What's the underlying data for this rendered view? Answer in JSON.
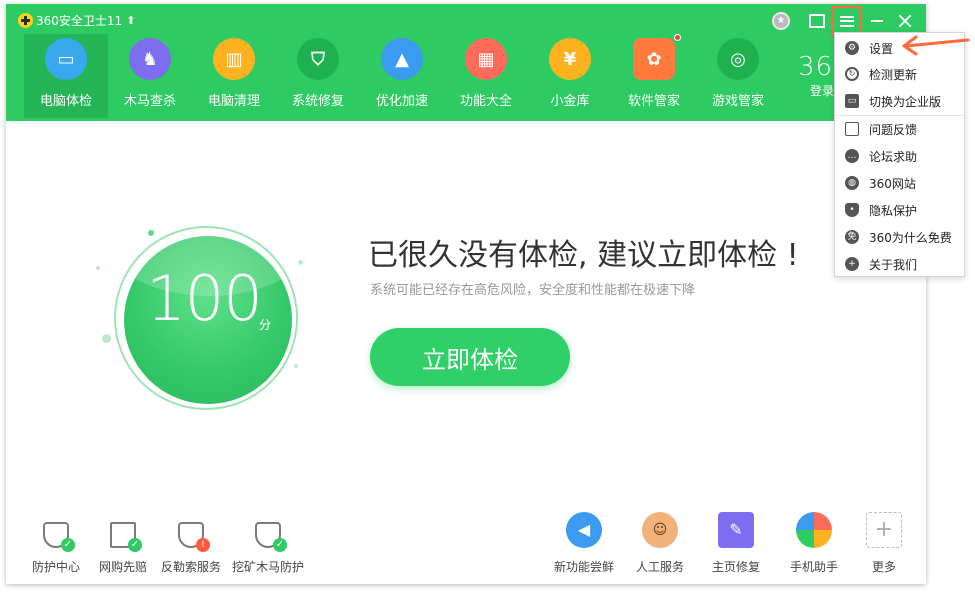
{
  "window": {
    "title": "360安全卫士11",
    "upgrade_icon": "arrow-up-icon"
  },
  "controls": {
    "medal_icon": "medal-icon",
    "skin_icon": "tshirt-icon",
    "menu_icon": "hamburger-menu-icon",
    "minimize_icon": "minimize-icon",
    "close_icon": "close-icon"
  },
  "nav": [
    {
      "label": "电脑体检",
      "icon": "monitor-icon",
      "color": "#3aa8f0",
      "active": true
    },
    {
      "label": "木马查杀",
      "icon": "horse-icon",
      "color": "#7f6df0"
    },
    {
      "label": "电脑清理",
      "icon": "broom-icon",
      "color": "#ffb21f"
    },
    {
      "label": "系统修复",
      "icon": "shield-icon",
      "color": "#1fb14f"
    },
    {
      "label": "优化加速",
      "icon": "rocket-icon",
      "color": "#3a9bf0"
    },
    {
      "label": "功能大全",
      "icon": "grid-icon",
      "color": "#ff6b5a"
    },
    {
      "label": "小金库",
      "icon": "money-bag-icon",
      "color": "#ffb21f"
    },
    {
      "label": "软件管家",
      "icon": "app-store-icon",
      "color": "#ff7a3d"
    },
    {
      "label": "游戏管家",
      "icon": "gamepad-icon",
      "color": "#1fb14f"
    }
  ],
  "login": {
    "logo_text": "36",
    "label": "登录"
  },
  "score": {
    "value": "100",
    "unit": "分"
  },
  "main": {
    "headline": "已很久没有体检, 建议立即体检 !",
    "subline": "系统可能已经存在高危风险，安全度和性能都在极速下降",
    "check_button": "立即体检"
  },
  "tools_left": [
    {
      "label": "防护中心",
      "icon": "shield-heartbeat-icon",
      "status": "ok"
    },
    {
      "label": "网购先赔",
      "icon": "shopping-cart-icon",
      "status": "ok"
    },
    {
      "label": "反勒索服务",
      "icon": "document-shield-icon",
      "status": "warning"
    },
    {
      "label": "挖矿木马防护",
      "icon": "lock-shield-icon",
      "status": "ok"
    }
  ],
  "tools_right": [
    {
      "label": "新功能尝鲜",
      "icon": "megaphone-icon",
      "color": "#3a9bf0"
    },
    {
      "label": "人工服务",
      "icon": "support-person-icon",
      "color": "#f0b27a"
    },
    {
      "label": "主页修复",
      "icon": "wrench-icon",
      "color": "#7f6df0"
    },
    {
      "label": "手机助手",
      "icon": "phone-assistant-icon",
      "color": "#ff6b5a"
    },
    {
      "label": "更多",
      "icon": "plus-icon",
      "color": "#bbbbbb"
    }
  ],
  "menu": {
    "group1": [
      {
        "label": "设置",
        "icon": "gear-icon"
      },
      {
        "label": "检测更新",
        "icon": "refresh-icon"
      },
      {
        "label": "切换为企业版",
        "icon": "enterprise-monitor-icon"
      }
    ],
    "group2": [
      {
        "label": "问题反馈",
        "icon": "feedback-icon"
      },
      {
        "label": "论坛求助",
        "icon": "chat-bubble-icon"
      },
      {
        "label": "360网站",
        "icon": "globe-icon"
      },
      {
        "label": "隐私保护",
        "icon": "privacy-shield-icon"
      },
      {
        "label": "360为什么免费",
        "icon": "free-icon"
      },
      {
        "label": "关于我们",
        "icon": "plus-circle-icon"
      }
    ]
  },
  "annotation": {
    "arrow_color": "#ff6a3d"
  }
}
